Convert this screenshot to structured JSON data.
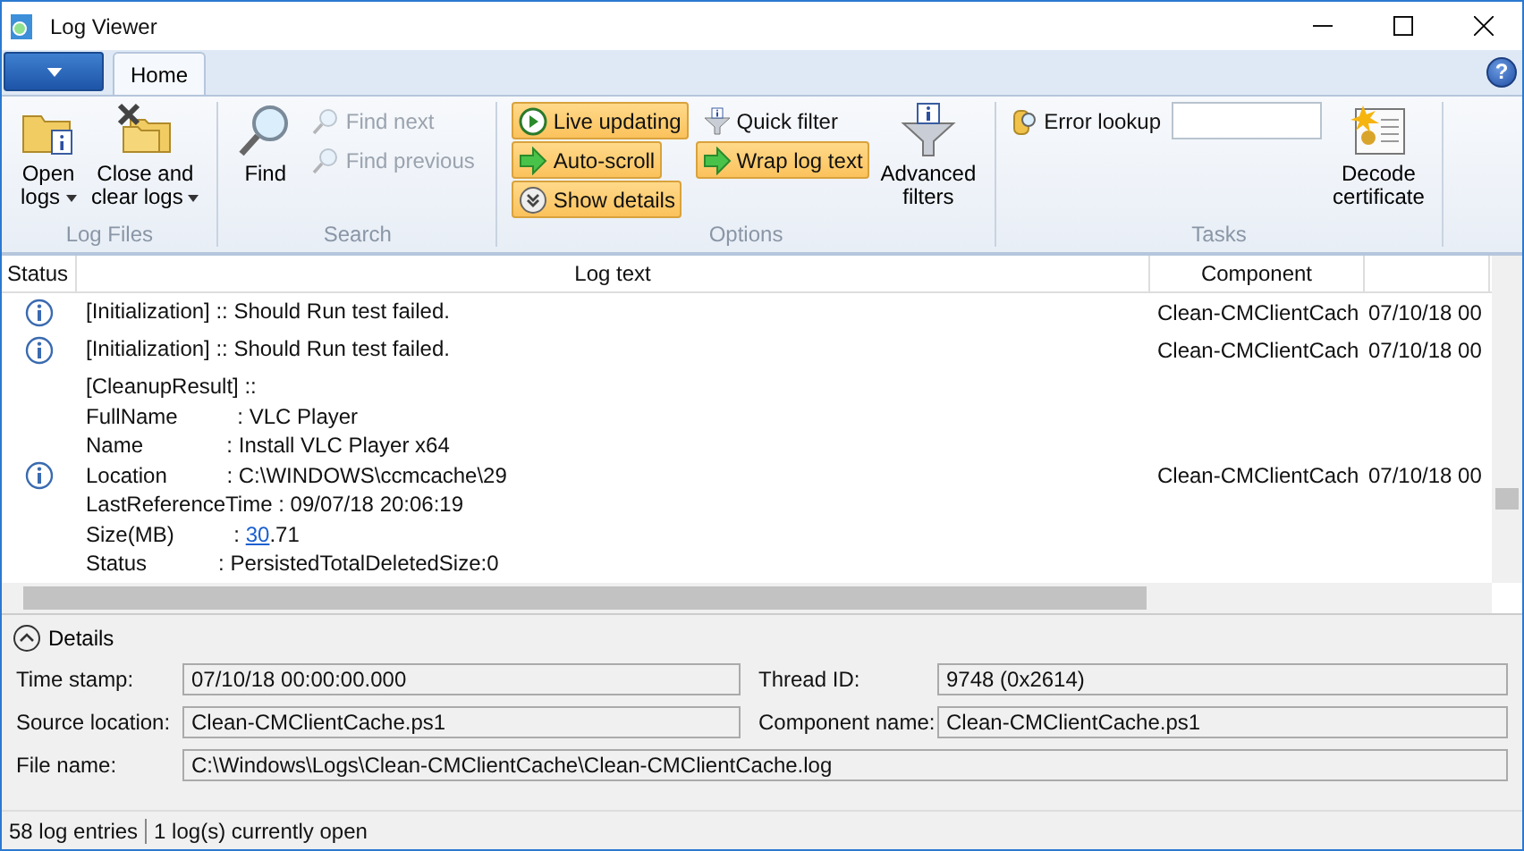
{
  "window": {
    "title": "Log Viewer"
  },
  "tabs": [
    {
      "label": "Home",
      "selected": true
    }
  ],
  "ribbon": {
    "groups": [
      {
        "title": "Log Files",
        "items": [
          {
            "kind": "large",
            "label": "Open\nlogs",
            "dropdown": true
          },
          {
            "kind": "large",
            "label": "Close and\nclear logs",
            "dropdown": true
          }
        ]
      },
      {
        "title": "Search",
        "items": [
          {
            "kind": "large",
            "label": "Find",
            "dropdown": false
          },
          {
            "kind": "stack",
            "items": [
              {
                "label": "Find next",
                "disabled": true
              },
              {
                "label": "Find previous",
                "disabled": true
              }
            ]
          }
        ]
      },
      {
        "title": "Options",
        "items": [
          {
            "kind": "toggles",
            "items": [
              {
                "label": "Live updating",
                "on": true
              },
              {
                "label": "Auto-scroll",
                "on": true
              },
              {
                "label": "Show details",
                "on": true
              }
            ]
          },
          {
            "kind": "toggles",
            "items": [
              {
                "label": "Quick filter",
                "on": false
              },
              {
                "label": "Wrap log text",
                "on": true
              }
            ]
          },
          {
            "kind": "large",
            "label": "Advanced\nfilters",
            "dropdown": false
          }
        ]
      },
      {
        "title": "Tasks",
        "items": [
          {
            "kind": "lookup",
            "label": "Error lookup"
          },
          {
            "kind": "large",
            "label": "Decode\ncertificate",
            "dropdown": false
          }
        ]
      }
    ]
  },
  "help": "?",
  "table": {
    "columns": [
      "Status",
      "Log text",
      "Component"
    ],
    "rows": [
      {
        "lines": [
          {
            "text": "[Initialization] :: Should Run test failed."
          }
        ],
        "component": "Clean-CMClientCach",
        "column_4": "07/10/18 00"
      },
      {
        "lines": [
          {
            "text": "[Initialization] :: Should Run test failed."
          }
        ],
        "component": "Clean-CMClientCach",
        "column_4": "07/10/18 00"
      },
      {
        "lines": [
          {
            "text": "[CleanupResult] ::"
          },
          {
            "text": "FullName          : VLC Player"
          },
          {
            "text": "Name              : Install VLC Player x64"
          },
          {
            "text": "Location          : C:\\WINDOWS\\ccmcache\\29"
          },
          {
            "text": "LastReferenceTime : 09/07/18 20:06:19"
          },
          {
            "text": "Size(MB)          : ",
            "link": "30",
            "after": ".71"
          },
          {
            "text": "Status            : PersistedTotalDeletedSize:0"
          }
        ],
        "component": "Clean-CMClientCach",
        "column_4": "07/10/18 00"
      }
    ]
  },
  "details": {
    "title": "Details",
    "expanded": true,
    "fields": [
      {
        "label": "Time stamp:",
        "value": "07/10/18 00:00:00.000"
      },
      {
        "label": "Thread ID:",
        "value": "9748 (0x2614)"
      },
      {
        "label": "Source location:",
        "value": "Clean-CMClientCache.ps1"
      },
      {
        "label": "Component name:",
        "value": "Clean-CMClientCache.ps1"
      },
      {
        "label": "File name:",
        "value": "C:\\Windows\\Logs\\Clean-CMClientCache\\Clean-CMClientCache.log",
        "wide": true
      }
    ]
  },
  "status_bar": [
    "58 log entries",
    "1 log(s) currently open"
  ]
}
